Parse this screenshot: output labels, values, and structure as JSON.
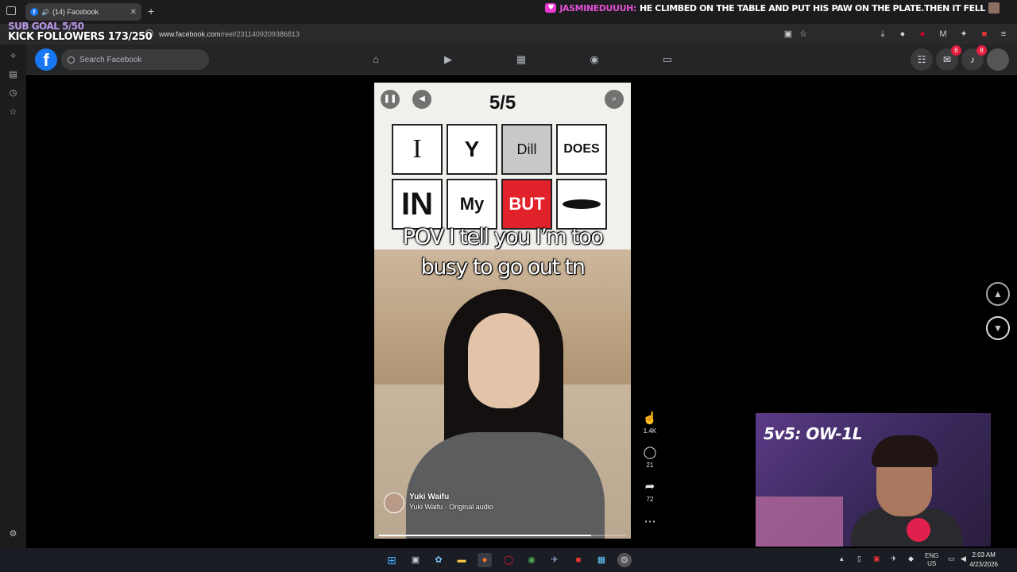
{
  "browser": {
    "tab_title": "(14) Facebook",
    "url_domain": "www.facebook.com",
    "url_path": "/reel/2311409209386813"
  },
  "stream_overlay": {
    "sub_goal": "SUB GOAL 5/50",
    "kick_followers": "KICK FOLLOWERS 173/250",
    "chat_user": "JASMINEDUUUH:",
    "chat_message": "HE CLIMBED ON THE TABLE AND PUT HIS PAW ON THE PLATE.THEN IT FELL",
    "webcam_title": "5v5: OW-1L"
  },
  "facebook": {
    "search_placeholder": "Search Facebook",
    "messenger_badge": "6",
    "notifications_badge": "8"
  },
  "reel": {
    "counter": "5/5",
    "tiles": [
      "I",
      "",
      "Dill",
      "DOES",
      "IN",
      "My",
      "BUT",
      ""
    ],
    "caption_line1": "POV I tell you I’m too",
    "caption_line2": "busy to go out tn",
    "author_name": "Yuki Waifu",
    "audio": "Yuki Waifu · Original audio",
    "progress": 0.86
  },
  "actions": {
    "likes": "1.4K",
    "comments": "21",
    "shares": "72"
  },
  "taskbar": {
    "lang1": "ENG",
    "lang2": "US",
    "time": "2:03 AM",
    "date": "4/23/2026"
  },
  "colors": {
    "fb_blue": "#1877f2",
    "badge_red": "#e41e3f",
    "tile_red": "#e1222a"
  }
}
